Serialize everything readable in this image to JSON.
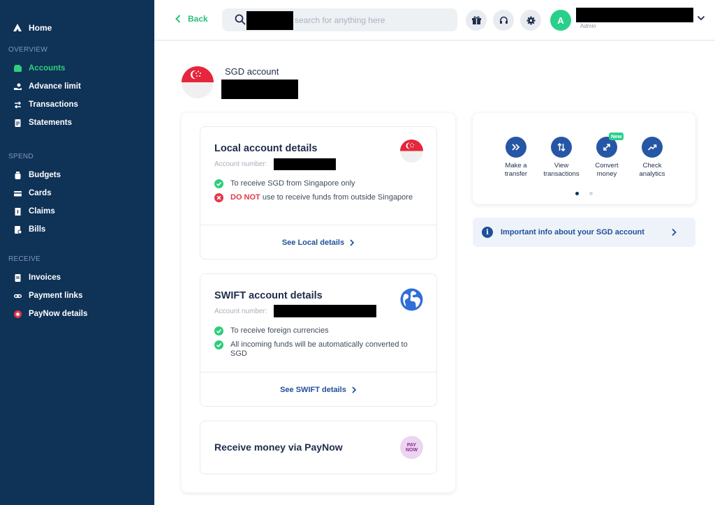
{
  "sidebar": {
    "home": "Home",
    "sections": {
      "overview": "OVERVIEW",
      "spend": "SPEND",
      "receive": "RECEIVE"
    },
    "items": {
      "accounts": "Accounts",
      "advance_limit": "Advance limit",
      "transactions": "Transactions",
      "statements": "Statements",
      "budgets": "Budgets",
      "cards": "Cards",
      "claims": "Claims",
      "bills": "Bills",
      "invoices": "Invoices",
      "payment_links": "Payment links",
      "paynow_details": "PayNow details"
    },
    "active_item": "accounts"
  },
  "topbar": {
    "back_label": "Back",
    "search_placeholder": "search for anything here",
    "avatar_initial": "A",
    "role": "Admin"
  },
  "account": {
    "title": "SGD account",
    "local": {
      "title": "Local account details",
      "account_number_label": "Account number:",
      "check1": "To receive SGD from Singapore only",
      "warn_strong": "DO NOT",
      "warn_rest": " use to receive funds from outside Singapore",
      "link": "See Local details"
    },
    "swift": {
      "title": "SWIFT account details",
      "account_number_label": "Account number:",
      "check1": "To receive foreign currencies",
      "check2": "All incoming funds will be automatically converted to SGD",
      "link": "See SWIFT details"
    },
    "paynow": {
      "title": "Receive money via PayNow",
      "logo_text": "PAY NOW"
    }
  },
  "quick_actions": [
    {
      "label1": "Make a",
      "label2": "transfer",
      "icon": "double-chevron-right-icon"
    },
    {
      "label1": "View",
      "label2": "transactions",
      "icon": "up-down-arrows-icon"
    },
    {
      "label1": "Convert",
      "label2": "money",
      "icon": "convert-icon",
      "badge": "New"
    },
    {
      "label1": "Check",
      "label2": "analytics",
      "icon": "trend-up-icon"
    }
  ],
  "carousel": {
    "pages": 2,
    "active": 1
  },
  "info_banner": "Important info about your SGD account",
  "colors": {
    "sidebar_bg": "#0f3257",
    "accent_green": "#2fcf7b",
    "primary_blue": "#2656a6",
    "danger_red": "#e5374b"
  }
}
